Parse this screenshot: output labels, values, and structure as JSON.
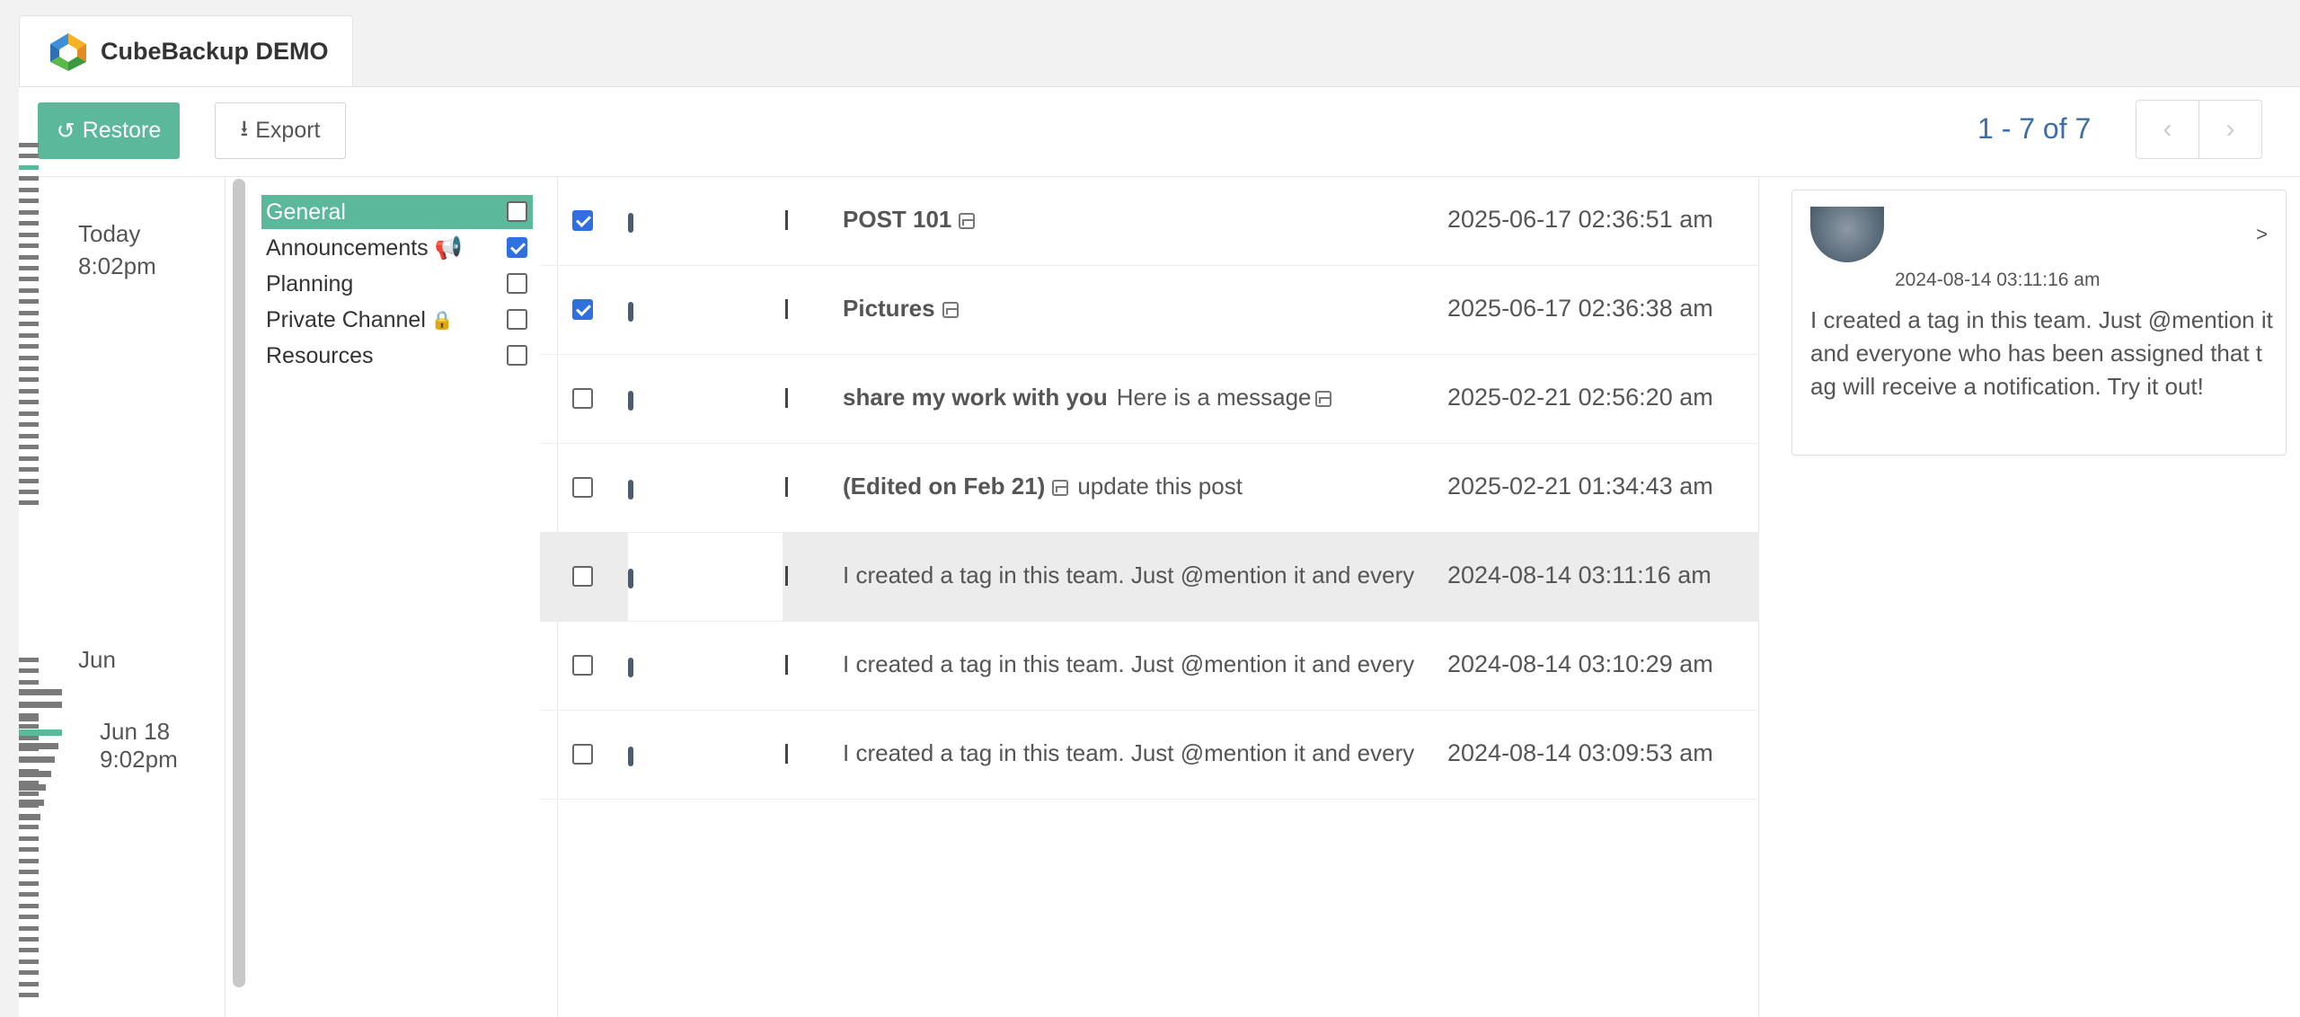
{
  "app": {
    "tab_title": "CubeBackup DEMO",
    "icon": "cubebackup-logo-icon"
  },
  "toolbar": {
    "restore_label": "Restore",
    "export_label": "Export",
    "pagination": "1 - 7 of 7"
  },
  "timeline": {
    "labels": [
      {
        "text": "Today"
      },
      {
        "text": "8:02pm"
      },
      {
        "text": "Jun"
      },
      {
        "text": "Jun 18 9:02pm"
      }
    ]
  },
  "channels": [
    {
      "name": "General",
      "checked": false,
      "active": true,
      "suffix": ""
    },
    {
      "name": "Announcements 📢",
      "checked": true,
      "active": false,
      "suffix": ""
    },
    {
      "name": "Planning",
      "checked": false,
      "active": false,
      "suffix": ""
    },
    {
      "name": "Private Channel",
      "checked": false,
      "active": false,
      "suffix": "lock-icon"
    },
    {
      "name": "Resources",
      "checked": false,
      "active": false,
      "suffix": ""
    }
  ],
  "posts": [
    {
      "checked": true,
      "bold": "POST 101",
      "image": true,
      "text": "",
      "date": "2025-06-17 02:36:51 am"
    },
    {
      "checked": true,
      "bold": "Pictures",
      "image": true,
      "text": "",
      "date": "2025-06-17 02:36:38 am"
    },
    {
      "checked": false,
      "bold": "share my work with you",
      "image": false,
      "text": "Here is a message",
      "date": "2025-02-21 02:56:20 am"
    },
    {
      "checked": false,
      "bold": "(Edited on Feb 21)",
      "image": true,
      "text": "update this post",
      "date": "2025-02-21 01:34:43 am"
    },
    {
      "checked": false,
      "bold": "",
      "image": false,
      "text": "I created a tag in this team. Just @mention it and every",
      "date": "2024-08-14 03:11:16 am"
    },
    {
      "checked": false,
      "bold": "",
      "image": false,
      "text": "I created a tag in this team. Just @mention it and every",
      "date": "2024-08-14 03:10:29 am"
    },
    {
      "checked": false,
      "bold": "",
      "image": false,
      "text": "I created a tag in this team. Just @mention it and every",
      "date": "2024-08-14 03:09:53 am"
    }
  ],
  "detail": {
    "date": "2024-08-14 03:11:16 am",
    "more": ">",
    "text": "I created a tag in this team. Just @mention it and everyone who has been assigned that tag will receive a notification. Try it out!"
  },
  "colors": {
    "accent": "#5bb89a",
    "link": "#3b6ea8",
    "checkbox": "#2f6fe0"
  }
}
